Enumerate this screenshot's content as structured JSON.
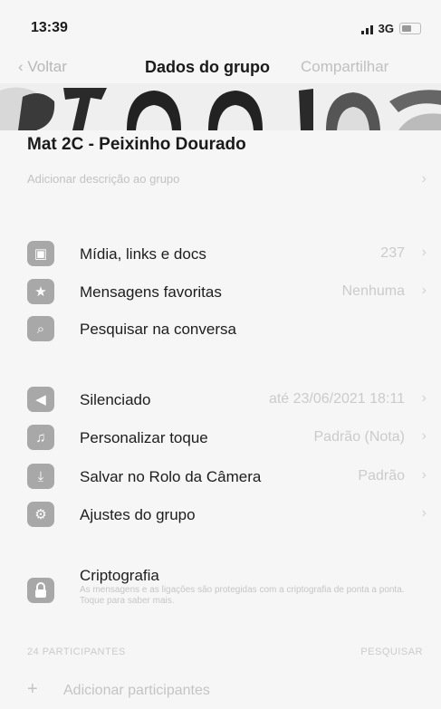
{
  "status_bar": {
    "time": "13:39",
    "network": "3G"
  },
  "nav": {
    "back": "Voltar",
    "title": "Dados do grupo",
    "share": "Compartilhar"
  },
  "group": {
    "name": "Mat 2C - Peixinho Dourado",
    "description_placeholder": "Adicionar descrição ao grupo"
  },
  "section1": [
    {
      "icon": "media-icon",
      "glyph": "▣",
      "label": "Mídia, links e docs",
      "value": "237"
    },
    {
      "icon": "star-icon",
      "glyph": "★",
      "label": "Mensagens favoritas",
      "value": "Nenhuma"
    },
    {
      "icon": "search-icon",
      "glyph": "⌕",
      "label": "Pesquisar na conversa",
      "value": ""
    }
  ],
  "section2": [
    {
      "icon": "mute-icon",
      "glyph": "🔇",
      "label": "Silenciado",
      "value": "até 23/06/2021 18:11"
    },
    {
      "icon": "music-note-icon",
      "glyph": "♫",
      "label": "Personalizar toque",
      "value": "Padrão (Nota)"
    },
    {
      "icon": "save-icon",
      "glyph": "⤓",
      "label": "Salvar no Rolo da Câmera",
      "value": "Padrão"
    },
    {
      "icon": "settings-icon",
      "glyph": "⚙",
      "label": "Ajustes do grupo",
      "value": ""
    }
  ],
  "encryption": {
    "title": "Criptografia",
    "subtitle": "As mensagens e as ligações são protegidas com a criptografia de ponta a ponta. Toque para saber mais."
  },
  "participants": {
    "header": "24 PARTICIPANTES",
    "search": "PESQUISAR",
    "add": "Adicionar participantes"
  }
}
